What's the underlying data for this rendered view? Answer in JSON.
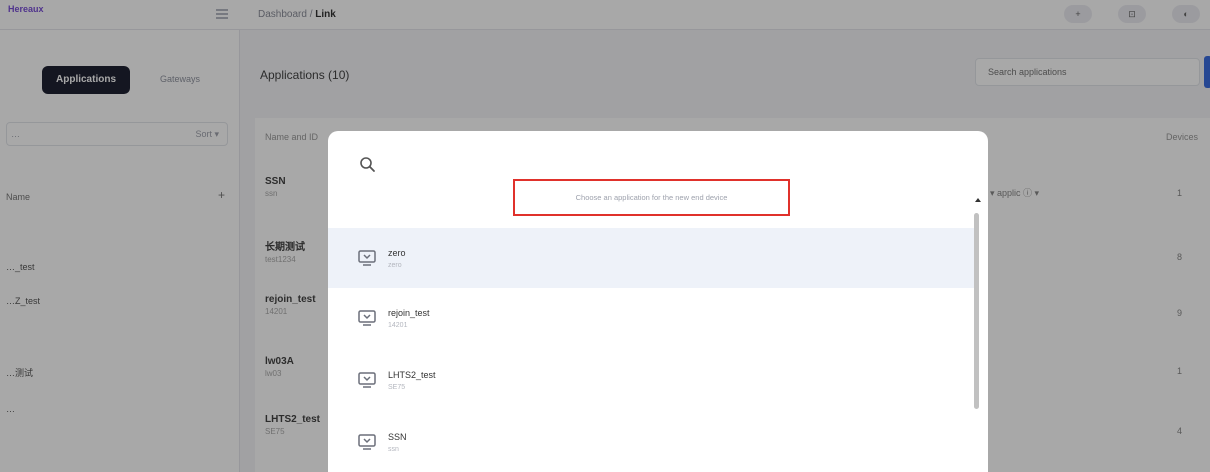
{
  "header": {
    "brand": "Hereaux",
    "breadcrumb_prefix": "Dashboard /",
    "breadcrumb_current": "Link",
    "actions": [
      "+",
      "⊡",
      "◐"
    ]
  },
  "sidebar": {
    "tab_active": "Applications",
    "tab_other": "Gateways",
    "search_text": "…",
    "search_select": "Sort ▾",
    "section_label": "Name",
    "add_symbol": "+",
    "items": [
      "…_test",
      "…Z_test",
      "…测试",
      "…"
    ]
  },
  "main": {
    "title": "Applications (10)",
    "search_placeholder": "Search applications",
    "col_left": "Name and ID",
    "col_right": "Devices",
    "filter": "▾ applic ⓘ ▾",
    "rows": [
      {
        "name": "SSN",
        "sub": "ssn",
        "count": "1"
      },
      {
        "name": "长期测试",
        "sub": "test1234",
        "count": "8"
      },
      {
        "name": "rejoin_test",
        "sub": "14201",
        "count": "9"
      },
      {
        "name": "lw03A",
        "sub": "lw03",
        "count": "1"
      },
      {
        "name": "LHTS2_test",
        "sub": "SE75",
        "count": "4"
      }
    ]
  },
  "modal": {
    "search_icon": "search-icon",
    "input_placeholder": "Choose an application for the new end device",
    "scroll_up_icon": "scroll-up-arrow-icon",
    "options": [
      {
        "icon": "application-icon",
        "name": "zero",
        "sub": "zero",
        "active": true
      },
      {
        "icon": "application-icon",
        "name": "rejoin_test",
        "sub": "14201",
        "active": false
      },
      {
        "icon": "application-icon",
        "name": "LHTS2_test",
        "sub": "SE75",
        "active": false
      },
      {
        "icon": "application-icon",
        "name": "SSN",
        "sub": "ssn",
        "active": false
      }
    ]
  },
  "colors": {
    "overlay": "rgba(0,0,0,0.34)",
    "input_border": "#e0312b",
    "active_option_bg": "#eef2f9",
    "sidebar_tab_bg": "#1f2233",
    "primary": "#3b6de0"
  }
}
